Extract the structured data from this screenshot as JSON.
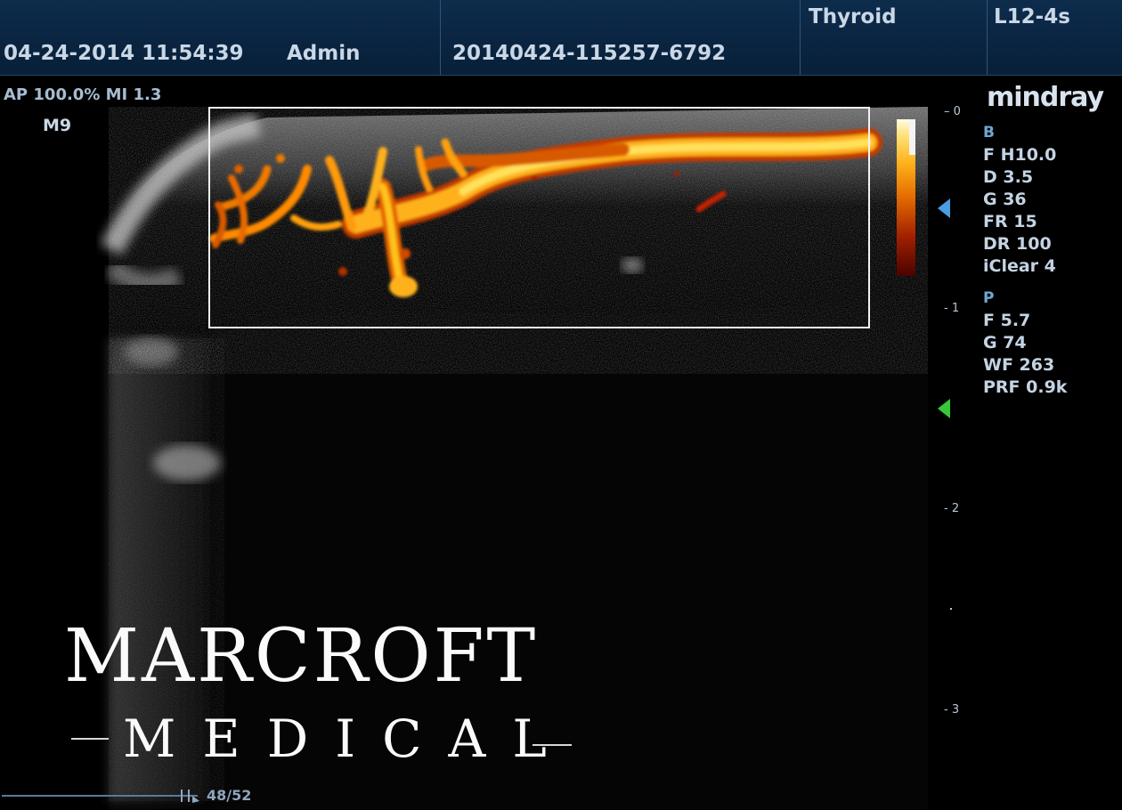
{
  "header": {
    "datetime": "04-24-2014 11:54:39",
    "user": "Admin",
    "exam_id": "20140424-115257-6792",
    "exam_preset": "Thyroid",
    "probe": "L12-4s"
  },
  "acoustic": {
    "ap_mi": "AP 100.0%  MI 1.3",
    "frequency_mode": "M9"
  },
  "brand": "mindray",
  "b_mode": {
    "label": "B",
    "items": [
      "F H10.0",
      "D 3.5",
      "G 36",
      "FR 15",
      "DR 100",
      "iClear 4"
    ]
  },
  "power_mode": {
    "label": "P",
    "items": [
      "F 5.7",
      "G 74",
      "WF 263",
      "PRF 0.9k"
    ]
  },
  "depth_scale": {
    "ticks": [
      "0",
      "1",
      "2",
      "3"
    ]
  },
  "watermark": {
    "line1": "MARCROFT",
    "line2": "MEDICAL"
  },
  "cine": {
    "frame": "48/52"
  },
  "colors": {
    "header_bg": "#0a2440",
    "accent_blue": "#4b9ce2",
    "focus_green": "#36c83a",
    "doppler_hot": "#ffb11a"
  }
}
